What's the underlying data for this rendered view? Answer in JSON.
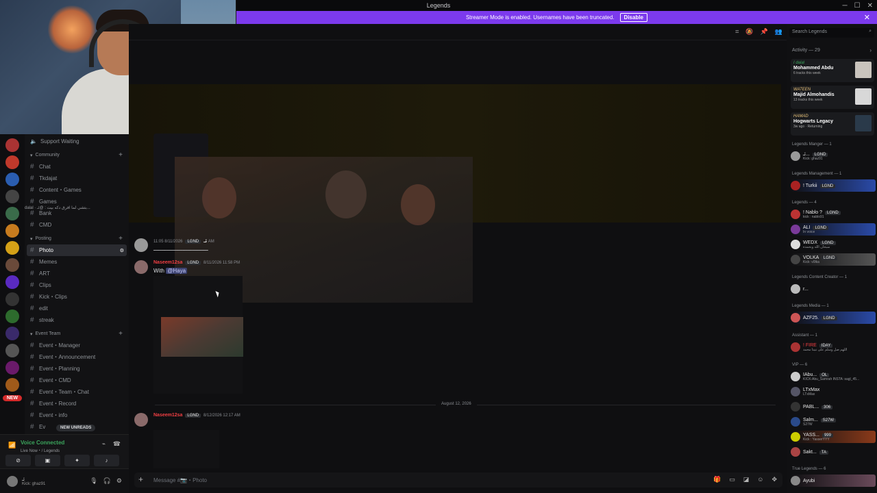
{
  "window": {
    "title": "Legends"
  },
  "banner": {
    "text": "Streamer Mode is enabled. Usernames have been truncated.",
    "disable_label": "Disable"
  },
  "sidebar": {
    "top_channel": "Support Waiting",
    "categories": [
      {
        "label": "Community",
        "channels": [
          "Chat",
          "Tkdajat",
          "Content・Games",
          "Games",
          "Bank",
          "CMD"
        ]
      },
      {
        "label": "Posting",
        "channels": [
          "Photo",
          "Memes",
          "ART",
          "Clips",
          "Kick・Clips",
          "edit",
          "streak"
        ]
      },
      {
        "label": "Event Team",
        "channels": [
          "Event・Manager",
          "Event・Announcement",
          "Event・Planning",
          "Event・CMD",
          "Event・Team・Chat",
          "Event・Record",
          "Event・info",
          "Ev"
        ]
      }
    ],
    "active_channel": "Photo",
    "new_unreads": "NEW UNREADS",
    "rail_new_badge": "NEW"
  },
  "voice": {
    "status": "Voice Connected",
    "location": "Live Now・/ Legends"
  },
  "user": {
    "name": "ئـ",
    "status": "Kick: ghaz91"
  },
  "chat": {
    "reply_snippet": "dalal  ·  بتشي لما افرق دكه بيت  : @ئـ...",
    "messages": [
      {
        "author": "ئـ",
        "badge": "LGND",
        "timestamp": "8/11/2026 11:05 AM",
        "text": "ــــــــــــــــــــــــــــــــــ"
      },
      {
        "author": "Naseem12sa",
        "badge": "LGND",
        "timestamp": "8/11/2026 11:58 PM",
        "text_prefix": "With",
        "mention": "@Haya"
      },
      {
        "author": "Naseem12sa",
        "badge": "LGND",
        "timestamp": "8/12/2026 12:17 AM"
      }
    ],
    "date_divider": "August 12, 2026",
    "composer_placeholder": "Message #📷・Photo"
  },
  "members": {
    "search_placeholder": "Search Legends",
    "activity_label": "Activity — 29",
    "activity_cards": [
      {
        "user": "I dalal",
        "title": "Mohammed Abdu",
        "detail": "6 tracks this week"
      },
      {
        "user": "WATEEN",
        "title": "Majid Almohandis",
        "detail": "13 tracks this week"
      },
      {
        "user": "HAMAD",
        "title": "Hogwarts Legacy",
        "detail": "3w ago · Returning"
      }
    ],
    "groups": [
      {
        "label": "Legends Manger — 1",
        "members": [
          {
            "name": "ئـ...",
            "badge": "LGND",
            "status": "Kick: ghaz91"
          }
        ]
      },
      {
        "label": "Legends Management — 1",
        "members": [
          {
            "name": "! Turkii",
            "badge": "LGND",
            "status": ""
          }
        ]
      },
      {
        "label": "Legends — 4",
        "members": [
          {
            "name": "! Nablo ?",
            "badge": "LGND",
            "status": "kick : nablo91"
          },
          {
            "name": "ALI",
            "badge": "LGND",
            "status": "In voice"
          },
          {
            "name": "WEDX",
            "badge": "LGND",
            "status": "سبحان الله وبحمده"
          },
          {
            "name": "VOLKA",
            "badge": "LGND",
            "status": "Kick: v0lka"
          }
        ]
      },
      {
        "label": "Legends Content Creator — 1",
        "members": [
          {
            "name": "r...",
            "badge": "",
            "status": ""
          }
        ]
      },
      {
        "label": "Legends Media — 1",
        "members": [
          {
            "name": "AZF25.",
            "badge": "LGND",
            "status": ""
          }
        ]
      },
      {
        "label": "Assistant — 1",
        "members": [
          {
            "name": "! FIRE",
            "badge": "IDAY",
            "status": "اللهم صل وسلم على نبينا محمد"
          }
        ]
      },
      {
        "label": "VIP — 6",
        "members": [
          {
            "name": "IAbu...",
            "badge": "OL",
            "status": "KICK:Abu_Samrah INSTA :sagl_45..."
          },
          {
            "name": "LTxMax",
            "badge": "",
            "status": "LTxMax"
          },
          {
            "name": "PABL...",
            "badge": "306",
            "status": ""
          },
          {
            "name": "Salm...",
            "badge": "S27W",
            "status": "S27W"
          },
          {
            "name": "YASS...",
            "badge": "999",
            "status": "Kick : YasserYYY"
          },
          {
            "name": "Sakt...",
            "badge": "TA",
            "status": ""
          }
        ]
      },
      {
        "label": "True Legends — 6",
        "members": [
          {
            "name": "Ayubi",
            "badge": "",
            "status": ""
          }
        ]
      }
    ]
  }
}
